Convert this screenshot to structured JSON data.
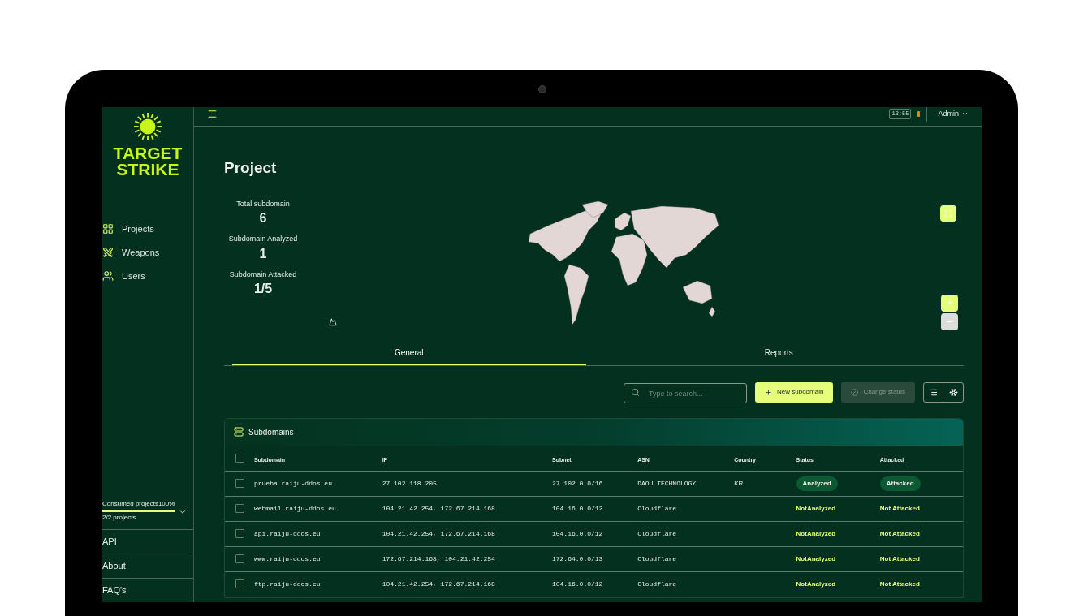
{
  "brand": {
    "line1": "TARGET",
    "line2": "STRIKE"
  },
  "nav": [
    {
      "label": "Projects",
      "kind": "grid",
      "selected": false
    },
    {
      "label": "Weapons",
      "kind": "weapon",
      "selected": false
    },
    {
      "label": "Users",
      "kind": "users",
      "selected": false
    }
  ],
  "usage": {
    "label": "Consumed projects",
    "percent": "100%",
    "level": 1,
    "count": "2/2 projects"
  },
  "footer_links": [
    "API",
    "About",
    "FAQ's"
  ],
  "topbar": {
    "time": "13:55",
    "user": "Admin"
  },
  "page_title": "Project",
  "stats": [
    {
      "label": "Total subdomain",
      "value": "6"
    },
    {
      "label": "Subdomain Analyzed",
      "value": "1"
    },
    {
      "label": "Subdomain Attacked",
      "value": "1/5"
    }
  ],
  "tabs": [
    {
      "label": "General",
      "selected": true
    },
    {
      "label": "Reports",
      "selected": false
    }
  ],
  "search": {
    "placeholder": "Type to search..."
  },
  "actions": [
    {
      "label": "New subdomain",
      "kind": "add",
      "disabled": false
    },
    {
      "label": "Change status",
      "kind": "status",
      "disabled": true
    }
  ],
  "table": {
    "title": "Subdomains",
    "select_all": {
      "checked": false
    },
    "columns": [
      "Subdomain",
      "IP",
      "Subnet",
      "ASN",
      "Country",
      "Status",
      "Attacked"
    ],
    "rows": [
      {
        "checked": false,
        "subdomain": "prueba.raiju-ddos.eu",
        "ip": "27.102.118.205",
        "subnet": "27.102.0.0/16",
        "asn": "DAOU TECHNOLOGY",
        "country": "KR",
        "status": {
          "text": "Analyzed",
          "kind": "pill"
        },
        "attacked": {
          "text": "Attacked",
          "kind": "pill"
        }
      },
      {
        "checked": false,
        "subdomain": "webmail.raiju-ddos.eu",
        "ip": "104.21.42.254, 172.67.214.168",
        "subnet": "104.16.0.0/12",
        "asn": "Cloudflare",
        "status": {
          "text": "NotAnalyzed",
          "kind": "plain"
        },
        "attacked": {
          "text": "Not Attacked",
          "kind": "plain"
        }
      },
      {
        "checked": false,
        "subdomain": "api.raiju-ddos.eu",
        "ip": "104.21.42.254, 172.67.214.168",
        "subnet": "104.16.0.0/12",
        "asn": "Cloudflare",
        "status": {
          "text": "NotAnalyzed",
          "kind": "plain"
        },
        "attacked": {
          "text": "Not Attacked",
          "kind": "plain"
        }
      },
      {
        "checked": false,
        "subdomain": "www.raiju-ddos.eu",
        "ip": "172.67.214.168, 104.21.42.254",
        "subnet": "172.64.0.0/13",
        "asn": "Cloudflare",
        "status": {
          "text": "NotAnalyzed",
          "kind": "plain"
        },
        "attacked": {
          "text": "Not Attacked",
          "kind": "plain"
        }
      },
      {
        "checked": false,
        "subdomain": "ftp.raiju-ddos.eu",
        "ip": "104.21.42.254, 172.67.214.168",
        "subnet": "104.16.0.0/12",
        "asn": "Cloudflare",
        "status": {
          "text": "NotAnalyzed",
          "kind": "plain"
        },
        "attacked": {
          "text": "Not Attacked",
          "kind": "plain"
        }
      }
    ]
  }
}
